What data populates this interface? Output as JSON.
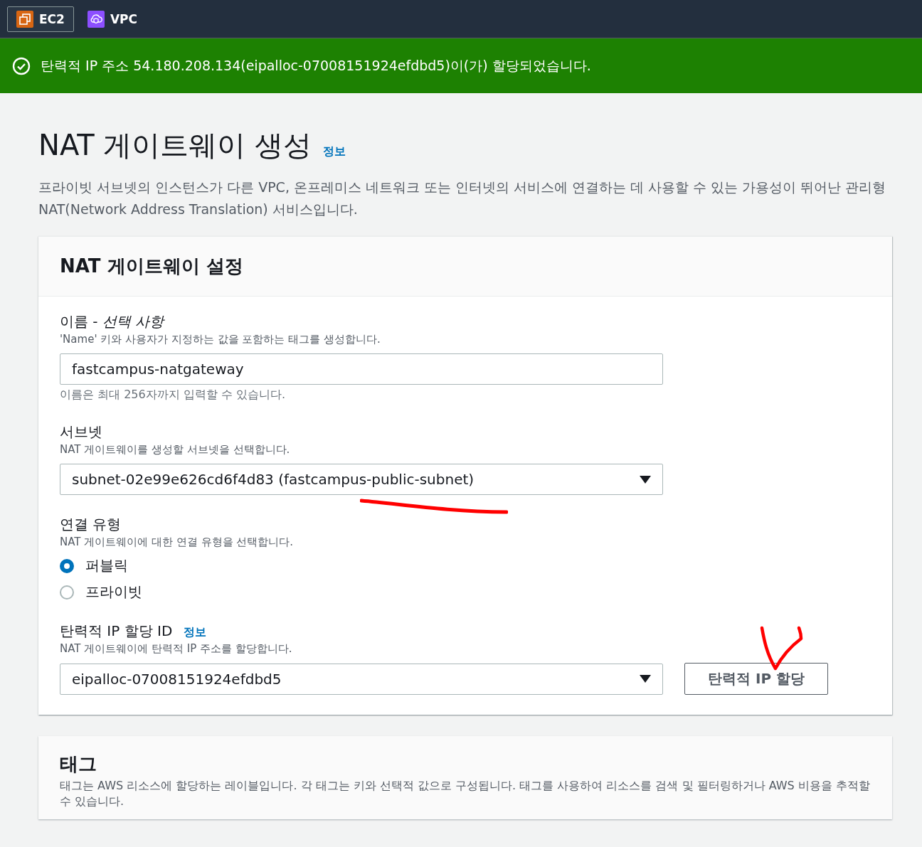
{
  "nav": {
    "services": [
      {
        "kind": "ec2",
        "label": "EC2",
        "selected": true
      },
      {
        "kind": "vpc",
        "label": "VPC",
        "selected": false
      }
    ]
  },
  "flash": {
    "kind": "success",
    "message": "탄력적 IP 주소 54.180.208.134(eipalloc-07008151924efdbd5)이(가) 할당되었습니다."
  },
  "header": {
    "title": "NAT 게이트웨이 생성",
    "info_link": "정보",
    "description": "프라이빗 서브넷의 인스턴스가 다른 VPC, 온프레미스 네트워크 또는 인터넷의 서비스에 연결하는 데 사용할 수 있는 가용성이 뛰어난 관리형 NAT(Network Address Translation) 서비스입니다."
  },
  "settings": {
    "title": "NAT 게이트웨이 설정",
    "fields": [
      {
        "kind": "text",
        "label": "이름 - *선택 사항*",
        "description": "'Name' 키와 사용자가 지정하는 값을 포함하는 태그를 생성합니다.",
        "value": "fastcampus-natgateway",
        "constraint": "이름은 최대 256자까지 입력할 수 있습니다."
      },
      {
        "kind": "select",
        "label": "서브넷",
        "description": "NAT 게이트웨이를 생성할 서브넷을 선택합니다.",
        "value": "subnet-02e99e626cd6f4d83 (fastcampus-public-subnet)",
        "annotation": {
          "kind": "underline"
        }
      },
      {
        "kind": "radio",
        "label": "연결 유형",
        "description": "NAT 게이트웨이에 대한 연결 유형을 선택합니다.",
        "options": [
          {
            "label": "퍼블릭",
            "selected": true
          },
          {
            "label": "프라이빗",
            "selected": false
          }
        ]
      },
      {
        "kind": "select",
        "label": "탄력적 IP 할당 ID",
        "info_link": "정보",
        "description": "NAT 게이트웨이에 탄력적 IP 주소를 할당합니다.",
        "value": "eipalloc-07008151924efdbd5",
        "button": "탄력적 IP 할당",
        "annotation": {
          "kind": "check"
        }
      }
    ]
  },
  "tags": {
    "title": "태그",
    "description": "태그는 AWS 리소스에 할당하는 레이블입니다. 각 태그는 키와 선택적 값으로 구성됩니다. 태그를 사용하여 리소스를 검색 및 필터링하거나 AWS 비용을 추적할 수 있습니다."
  }
}
